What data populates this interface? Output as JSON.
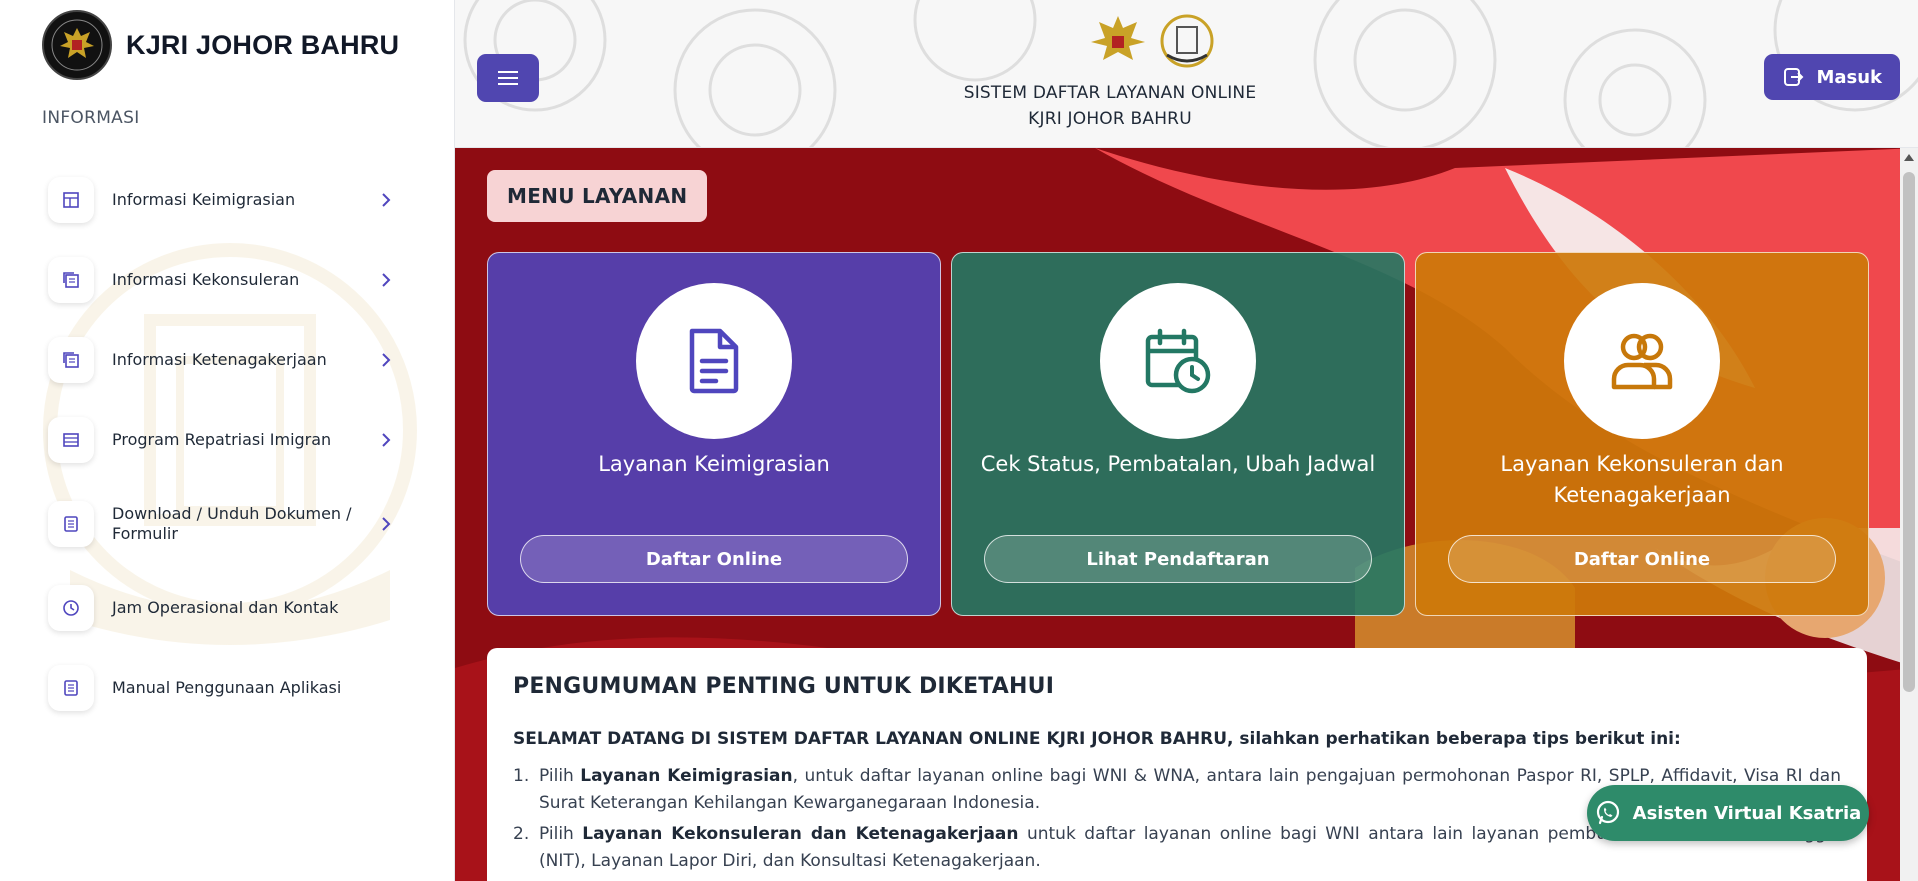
{
  "brand": {
    "title": "KJRI JOHOR BAHRU"
  },
  "sidebar": {
    "section_label": "INFORMASI",
    "items": [
      {
        "label": "Informasi Keimigrasian",
        "icon": "grid-doc-icon",
        "has_chevron": true
      },
      {
        "label": "Informasi Kekonsuleran",
        "icon": "copy-doc-icon",
        "has_chevron": true
      },
      {
        "label": "Informasi Ketenagakerjaan",
        "icon": "copy-doc-icon",
        "has_chevron": true
      },
      {
        "label": "Program Repatriasi Imigran",
        "icon": "table-icon",
        "has_chevron": true
      },
      {
        "label": "Download / Unduh Dokumen / Formulir",
        "icon": "document-icon",
        "has_chevron": true
      },
      {
        "label": "Jam Operasional dan Kontak",
        "icon": "clock-icon",
        "has_chevron": false
      },
      {
        "label": "Manual Penggunaan Aplikasi",
        "icon": "document-icon",
        "has_chevron": false
      }
    ]
  },
  "header": {
    "title_line1": "SISTEM DAFTAR LAYANAN ONLINE",
    "title_line2": "KJRI JOHOR BAHRU",
    "login_label": "Masuk"
  },
  "main": {
    "menu_label": "MENU LAYANAN",
    "cards": [
      {
        "title": "Layanan Keimigrasian",
        "button": "Daftar Online",
        "icon": "document-icon",
        "color": "#4f46be"
      },
      {
        "title": "Cek Status, Pembatalan, Ubah Jadwal",
        "button": "Lihat Pendaftaran",
        "icon": "calendar-clock-icon",
        "color": "#237864"
      },
      {
        "title": "Layanan Kekonsuleran dan Ketenagakerjaan",
        "button": "Daftar Online",
        "icon": "users-icon",
        "color": "#cd780a"
      }
    ],
    "announcement": {
      "title": "PENGUMUMAN PENTING UNTUK DIKETAHUI",
      "intro": "SELAMAT DATANG DI SISTEM DAFTAR LAYANAN ONLINE KJRI JOHOR BAHRU, silahkan perhatikan beberapa tips berikut ini:",
      "items": [
        {
          "num": "1.",
          "pre": "Pilih ",
          "bold": "Layanan Keimigrasian",
          "post": ", untuk daftar layanan online bagi WNI & WNA, antara lain pengajuan permohonan Paspor RI, SPLP, Affidavit, Visa RI dan Surat Keterangan Kehilangan Kewarganegaraan Indonesia."
        },
        {
          "num": "2.",
          "pre": "Pilih ",
          "bold": "Layanan Kekonsuleran dan Ketenagakerjaan",
          "post": " untuk daftar layanan online bagi WNI antara lain layanan pembuatan Nomor Induk Tunggal (NIT), Layanan Lapor Diri, dan Konsultasi Ketenagakerjaan."
        }
      ]
    }
  },
  "chat": {
    "label": "Asisten Virtual Ksatria"
  },
  "colors": {
    "primary": "#5046b0",
    "banner_red": "#8e0c12",
    "whatsapp_green": "#2e8b6a"
  }
}
